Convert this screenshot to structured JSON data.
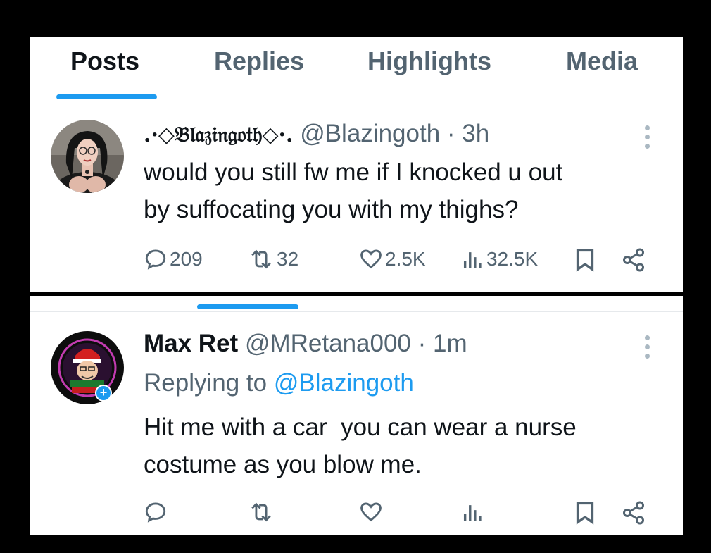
{
  "tabs": [
    {
      "label": "Posts",
      "active": true
    },
    {
      "label": "Replies",
      "active": false
    },
    {
      "label": "Highlights",
      "active": false
    },
    {
      "label": "Media",
      "active": false
    }
  ],
  "tweet1": {
    "display_name": ".·◇𝔅𝔩𝔞𝔷𝔦𝔫𝔤𝔬𝔱𝔥◇·.",
    "handle": "@Blazingoth",
    "time": "· 3h",
    "text_line1": "would you still fw me if I knocked u out",
    "text_line2": "by suffocating you with my thighs?",
    "replies": "209",
    "reposts": "32",
    "likes": "2.5K",
    "views": "32.5K"
  },
  "tweet2": {
    "display_name": "Max Ret",
    "handle": "@MRetana000",
    "time": "· 1m",
    "replying_prefix": "Replying to",
    "replying_to": "@Blazingoth",
    "text_line1": "Hit me with a car  you can wear a nurse",
    "text_line2": "costume as you blow me.",
    "badge": "+"
  },
  "colors": {
    "accent": "#1d9bf0",
    "text_primary": "#0f1419",
    "text_secondary": "#536471"
  },
  "icons": [
    "reply-icon",
    "repost-icon",
    "like-icon",
    "views-icon",
    "bookmark-icon",
    "share-icon",
    "more-icon"
  ]
}
